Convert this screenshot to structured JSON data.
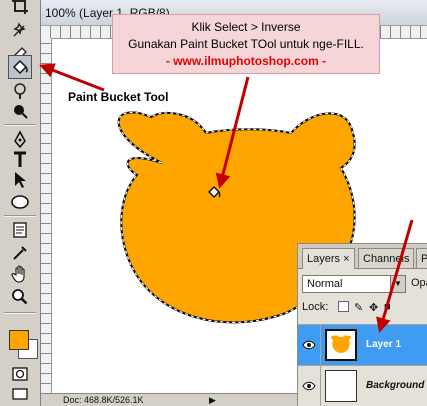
{
  "document": {
    "title": "100% (Layer 1, RGB/8)",
    "status_doc_info": "Doc: 468.8K/526.1K",
    "status_arrow": "▶"
  },
  "callout": {
    "line1": "Klik Select > Inverse",
    "line2": "Gunakan Paint Bucket TOol untuk nge-FILL.",
    "line3": "- www.ilmuphotoshop.com -"
  },
  "tool_label": "Paint Bucket Tool",
  "tools": [
    "crop-tool",
    "healing-brush-tool",
    "eraser-tool",
    "paint-bucket-tool",
    "dodge-tool",
    "blur-tool",
    "pen-tool",
    "type-tool",
    "path-selection-tool",
    "ellipse-tool",
    "notes-tool",
    "eyedropper-tool",
    "hand-tool",
    "zoom-tool"
  ],
  "colors": {
    "foreground": "#ffa500",
    "background": "#ffffff",
    "fill": "#ffa500",
    "callout_bg": "#f5d5d8",
    "arrow": "#c00000",
    "selected_layer": "#3f9cf0"
  },
  "layers_panel": {
    "tabs": [
      {
        "label": "Layers",
        "close": "×"
      },
      {
        "label": "Channels"
      },
      {
        "label": "P"
      }
    ],
    "blend_mode": "Normal",
    "opacity_label": "Opa",
    "lock_label": "Lock:",
    "layers": [
      {
        "name": "Layer 1",
        "selected": true
      },
      {
        "name": "Background",
        "selected": false
      }
    ]
  }
}
